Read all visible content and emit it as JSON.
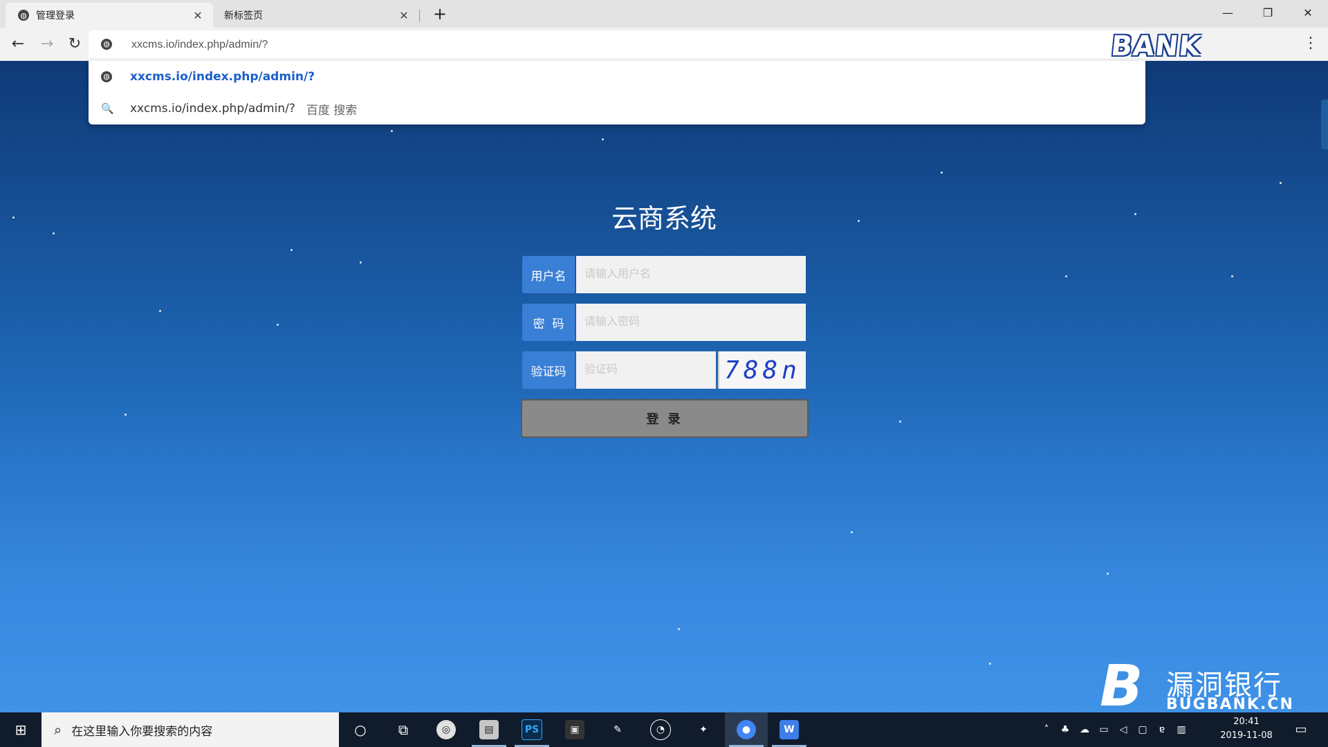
{
  "browser": {
    "tabs": [
      {
        "label": "管理登录",
        "active": true
      },
      {
        "label": "新标签页",
        "active": false
      }
    ],
    "new_tab_icon": "+",
    "address_value": "xxcms.io/index.php/admin/?",
    "suggestions": [
      {
        "type": "url",
        "text": "xxcms.io/index.php/admin/?"
      },
      {
        "type": "search",
        "text": "xxcms.io/index.php/admin/?",
        "hint": "百度 搜索"
      }
    ]
  },
  "watermark_top": "BANK",
  "login": {
    "title": "云商系统",
    "username_label": "用户名",
    "username_placeholder": "请输入用户名",
    "password_label": "密  码",
    "password_placeholder": "请输入密码",
    "captcha_label": "验证码",
    "captcha_placeholder": "验证码",
    "captcha_text": "788n",
    "submit_label": "登 录"
  },
  "watermark_bottom": {
    "logo": "B",
    "cn": "漏洞银行",
    "en": "BUGBANK.CN"
  },
  "taskbar": {
    "search_placeholder": "在这里输入你要搜索的内容",
    "apps": [
      "cortana-icon",
      "task-view-icon",
      "app-icon-1",
      "app-icon-2",
      "photoshop-icon",
      "app-icon-3",
      "app-icon-4",
      "app-icon-5",
      "app-icon-6",
      "chrome-icon",
      "wps-icon"
    ],
    "ps_label": "PS",
    "time": "20:41",
    "date": "2019-11-08"
  },
  "colors": {
    "accent": "#3a7fd6",
    "captcha": "#1b3fc7",
    "suggestion_url": "#1a5fc9"
  }
}
